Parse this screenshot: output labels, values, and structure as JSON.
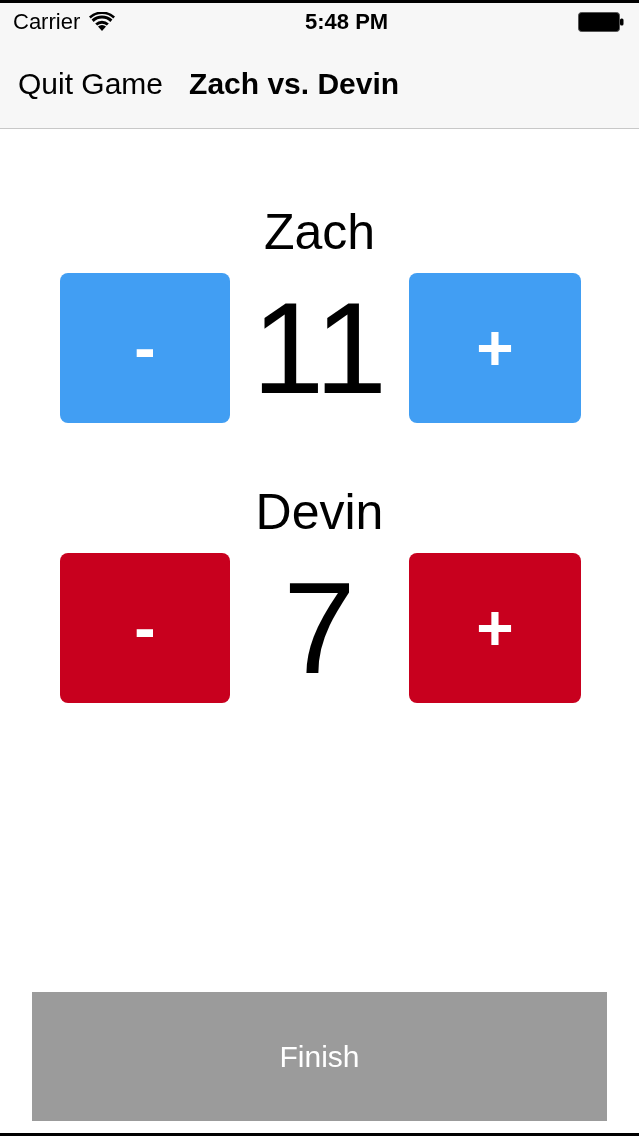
{
  "status_bar": {
    "carrier": "Carrier",
    "time": "5:48 PM"
  },
  "nav_bar": {
    "back_button": "Quit Game",
    "title": "Zach vs. Devin"
  },
  "players": [
    {
      "name": "Zach",
      "score": "11",
      "color": "#419ef3",
      "decrement": "-",
      "increment": "+"
    },
    {
      "name": "Devin",
      "score": "7",
      "color": "#c8001e",
      "decrement": "-",
      "increment": "+"
    }
  ],
  "finish_button": {
    "label": "Finish"
  }
}
